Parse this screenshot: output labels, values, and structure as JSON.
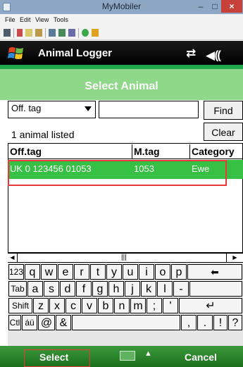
{
  "host": {
    "title": "MyMobiler",
    "menu": [
      "File",
      "Edit",
      "View",
      "Tools"
    ],
    "window_buttons": {
      "minimize": "–",
      "maximize": "□",
      "close": "×"
    }
  },
  "device": {
    "app_title": "Animal Logger",
    "connectivity_icon": "⇄",
    "volume_icon": "◀⸨"
  },
  "screen": {
    "section_title": "Select Animal",
    "filter": {
      "selected": "Off. tag",
      "search_value": ""
    },
    "find_label": "Find",
    "clear_label": "Clear",
    "count_text": "1 animal listed",
    "columns": [
      "Off.tag",
      "M.tag",
      "Category"
    ],
    "rows": [
      {
        "off_tag": "UK 0 123456 01053",
        "m_tag": "1053",
        "category": "Ewe"
      }
    ]
  },
  "keyboard": {
    "rows": [
      [
        "123",
        "q",
        "w",
        "e",
        "r",
        "t",
        "y",
        "u",
        "i",
        "o",
        "p",
        "⬅"
      ],
      [
        "Tab",
        "a",
        "s",
        "d",
        "f",
        "g",
        "h",
        "j",
        "k",
        "l",
        "-",
        ""
      ],
      [
        "Shift",
        "z",
        "x",
        "c",
        "v",
        "b",
        "n",
        "m",
        ";",
        "'",
        "↵"
      ],
      [
        "Ctl",
        "áü",
        "@",
        "&",
        " ",
        ",",
        ".",
        "!",
        "?"
      ]
    ]
  },
  "softkeys": {
    "left": "Select",
    "right": "Cancel"
  },
  "colors": {
    "accent_green": "#1fa74a",
    "header_light": "#8fd88a",
    "selection": "#36c044",
    "highlight_box": "#e83838"
  }
}
